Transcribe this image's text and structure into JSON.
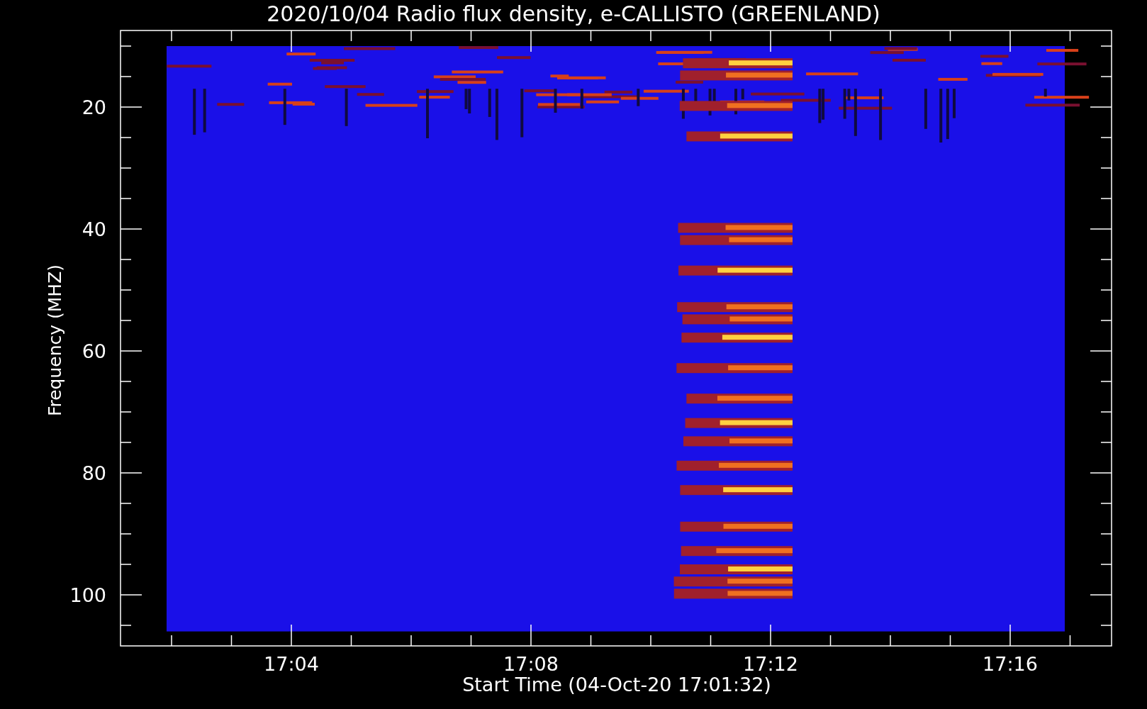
{
  "title": "2020/10/04  Radio flux density, e-CALLISTO (GREENLAND)",
  "y_axis": {
    "label": "Frequency (MHZ)",
    "ticks": [
      "20",
      "40",
      "60",
      "80",
      "100"
    ]
  },
  "x_axis": {
    "label": "Start Time (04-Oct-20 17:01:32)",
    "ticks": [
      "17:04",
      "17:08",
      "17:12",
      "17:16"
    ]
  }
}
